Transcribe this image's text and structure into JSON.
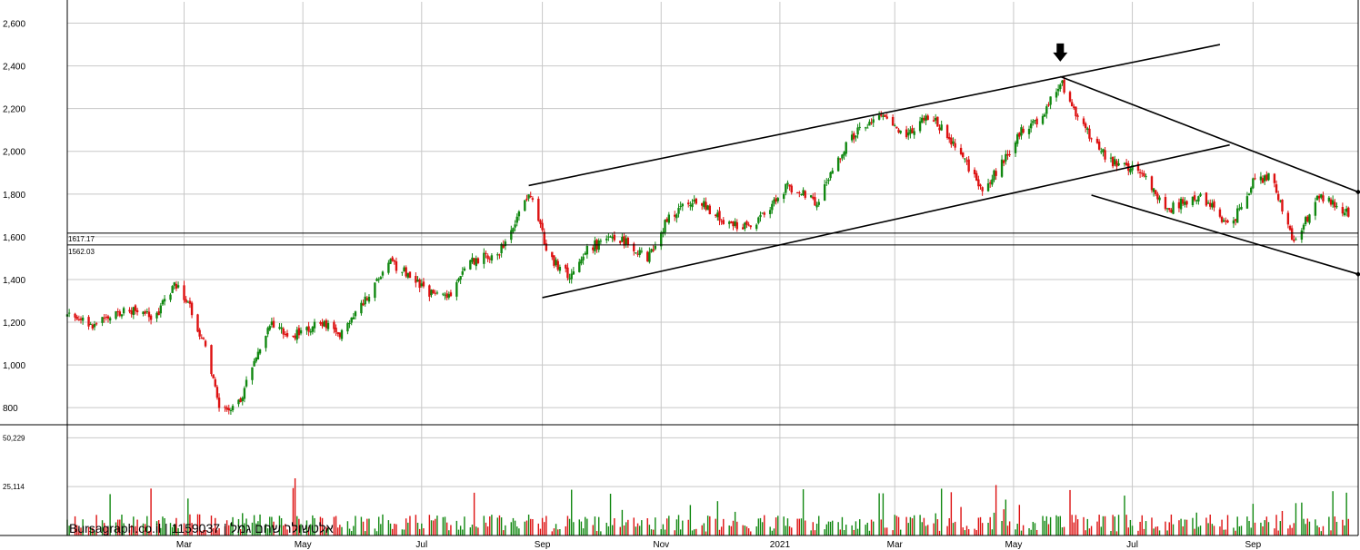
{
  "chart_data": {
    "type": "candlestick",
    "watermark": "Bursagraph.co.il | 1159037 | אלטשולר שחם גמל",
    "price_axis": {
      "ylim": [
        720,
        2700
      ],
      "ticks": [
        "800",
        "1,000",
        "1,200",
        "1,400",
        "1,600",
        "1,800",
        "2,000",
        "2,200",
        "2,400",
        "2,600"
      ]
    },
    "volume_axis": {
      "ylim": [
        0,
        56000
      ],
      "ticks": [
        "25,114",
        "50,229"
      ]
    },
    "x_axis": {
      "xlim": [
        "2020-01-01",
        "2021-10-25"
      ],
      "ticks": [
        {
          "date": "2020-03-01",
          "label": "Mar"
        },
        {
          "date": "2020-05-01",
          "label": "May"
        },
        {
          "date": "2020-07-01",
          "label": "Jul"
        },
        {
          "date": "2020-09-01",
          "label": "Sep"
        },
        {
          "date": "2020-11-01",
          "label": "Nov"
        },
        {
          "date": "2021-01-01",
          "label": "2021"
        },
        {
          "date": "2021-03-01",
          "label": "Mar"
        },
        {
          "date": "2021-05-01",
          "label": "May"
        },
        {
          "date": "2021-07-01",
          "label": "Jul"
        },
        {
          "date": "2021-09-01",
          "label": "Sep"
        }
      ]
    },
    "close_path": [
      [
        "2020-01-01",
        1230
      ],
      [
        "2020-01-15",
        1190
      ],
      [
        "2020-02-01",
        1260
      ],
      [
        "2020-02-15",
        1220
      ],
      [
        "2020-02-25",
        1380
      ],
      [
        "2020-03-05",
        1250
      ],
      [
        "2020-03-12",
        1080
      ],
      [
        "2020-03-20",
        780
      ],
      [
        "2020-03-28",
        790
      ],
      [
        "2020-04-05",
        1000
      ],
      [
        "2020-04-15",
        1200
      ],
      [
        "2020-04-25",
        1130
      ],
      [
        "2020-05-10",
        1200
      ],
      [
        "2020-05-20",
        1140
      ],
      [
        "2020-06-01",
        1300
      ],
      [
        "2020-06-15",
        1480
      ],
      [
        "2020-06-25",
        1420
      ],
      [
        "2020-07-05",
        1340
      ],
      [
        "2020-07-15",
        1320
      ],
      [
        "2020-07-25",
        1480
      ],
      [
        "2020-08-10",
        1530
      ],
      [
        "2020-08-25",
        1810
      ],
      [
        "2020-09-05",
        1500
      ],
      [
        "2020-09-15",
        1420
      ],
      [
        "2020-09-25",
        1550
      ],
      [
        "2020-10-10",
        1600
      ],
      [
        "2020-10-25",
        1490
      ],
      [
        "2020-11-05",
        1700
      ],
      [
        "2020-11-20",
        1780
      ],
      [
        "2020-12-05",
        1650
      ],
      [
        "2020-12-20",
        1660
      ],
      [
        "2021-01-05",
        1840
      ],
      [
        "2021-01-20",
        1760
      ],
      [
        "2021-02-05",
        2050
      ],
      [
        "2021-02-20",
        2170
      ],
      [
        "2021-03-05",
        2070
      ],
      [
        "2021-03-20",
        2170
      ],
      [
        "2021-04-05",
        1960
      ],
      [
        "2021-04-15",
        1820
      ],
      [
        "2021-04-25",
        1940
      ],
      [
        "2021-05-05",
        2100
      ],
      [
        "2021-05-15",
        2140
      ],
      [
        "2021-05-25",
        2330
      ],
      [
        "2021-06-05",
        2120
      ],
      [
        "2021-06-20",
        1950
      ],
      [
        "2021-07-05",
        1900
      ],
      [
        "2021-07-20",
        1730
      ],
      [
        "2021-08-05",
        1800
      ],
      [
        "2021-08-20",
        1640
      ],
      [
        "2021-09-01",
        1860
      ],
      [
        "2021-09-10",
        1880
      ],
      [
        "2021-09-22",
        1580
      ],
      [
        "2021-10-05",
        1790
      ],
      [
        "2021-10-20",
        1710
      ]
    ],
    "horizontal_levels": [
      {
        "value": 1617.17,
        "label": "1617.17"
      },
      {
        "value": 1562.03,
        "label": "1562.03"
      }
    ],
    "trendlines": [
      {
        "from": [
          "2020-08-25",
          1840
        ],
        "to": [
          "2021-08-15",
          2500
        ]
      },
      {
        "from": [
          "2020-09-01",
          1315
        ],
        "to": [
          "2021-08-20",
          2030
        ]
      },
      {
        "from": [
          "2021-05-25",
          2350
        ],
        "to": [
          "2021-10-25",
          1810
        ]
      },
      {
        "from": [
          "2021-06-10",
          1795
        ],
        "to": [
          "2021-10-25",
          1425
        ]
      }
    ],
    "marker": {
      "type": "arrow-down",
      "date": "2021-05-25",
      "value": 2420
    },
    "colors": {
      "up": "#118811",
      "down": "#dd1111",
      "line": "#000000",
      "grid": "#c8c8c8"
    }
  }
}
